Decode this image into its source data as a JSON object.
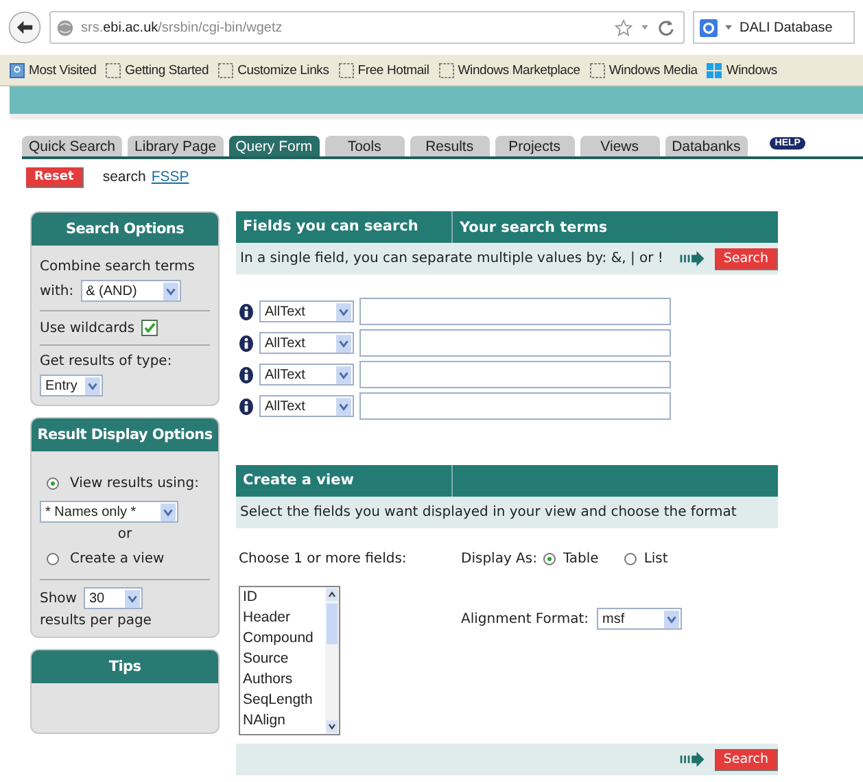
{
  "browser": {
    "url": "srs.**ebi.ac.uk**/srsbin/cgi-bin/wgetz",
    "search_engine_text": "DALI Database"
  },
  "bookmarks": [
    {
      "label": "Most Visited",
      "kind": "folder"
    },
    {
      "label": "Getting Started",
      "kind": "page"
    },
    {
      "label": "Customize Links",
      "kind": "page"
    },
    {
      "label": "Free Hotmail",
      "kind": "page"
    },
    {
      "label": "Windows Marketplace",
      "kind": "page"
    },
    {
      "label": "Windows Media",
      "kind": "page"
    },
    {
      "label": "Windows",
      "kind": "windows"
    }
  ],
  "tabs": [
    {
      "label": "Quick Search",
      "selected": false
    },
    {
      "label": "Library Page",
      "selected": false
    },
    {
      "label": "Query Form",
      "selected": true
    },
    {
      "label": "Tools",
      "selected": false
    },
    {
      "label": "Results",
      "selected": false
    },
    {
      "label": "Projects",
      "selected": false
    },
    {
      "label": "Views",
      "selected": false
    },
    {
      "label": "Databanks",
      "selected": false
    }
  ],
  "help_badge": "HELP",
  "reset_button": "Reset",
  "search_label": "search",
  "search_link": "FSSP",
  "search_options": {
    "title": "Search Options",
    "combine_label": "Combine search terms",
    "with_label": "with:",
    "combine_value": "& (AND)",
    "wildcards_label": "Use wildcards",
    "wildcards_checked": true,
    "result_type_label": "Get results of type:",
    "result_type_value": "Entry"
  },
  "display_options": {
    "title": "Result Display Options",
    "view_using_label": "View results using:",
    "view_using_selected": true,
    "view_value": "* Names only *",
    "or_text": "or",
    "create_view_label": "Create a view",
    "create_view_selected": false,
    "show_label": "Show",
    "show_value": "30",
    "per_page_label": "results per page"
  },
  "tips": {
    "title": "Tips"
  },
  "fields_panel": {
    "header_fields": "Fields you can search",
    "header_terms": "Your search terms",
    "hint": "In a single field, you can separate multiple values by: &, | or !",
    "search_button": "Search",
    "rows": [
      {
        "field": "AllText"
      },
      {
        "field": "AllText"
      },
      {
        "field": "AllText"
      },
      {
        "field": "AllText"
      }
    ]
  },
  "view_panel": {
    "title": "Create a view",
    "hint": "Select the fields you want displayed in your view and choose the format",
    "choose_label": "Choose 1 or more fields:",
    "fields": [
      "ID",
      "Header",
      "Compound",
      "Source",
      "Authors",
      "SeqLength",
      "NAlign"
    ],
    "display_as_label": "Display As:",
    "display_as": [
      {
        "label": "Table",
        "selected": true
      },
      {
        "label": "List",
        "selected": false
      }
    ],
    "alignment_label": "Alignment Format:",
    "alignment_value": "msf",
    "search_button": "Search"
  }
}
